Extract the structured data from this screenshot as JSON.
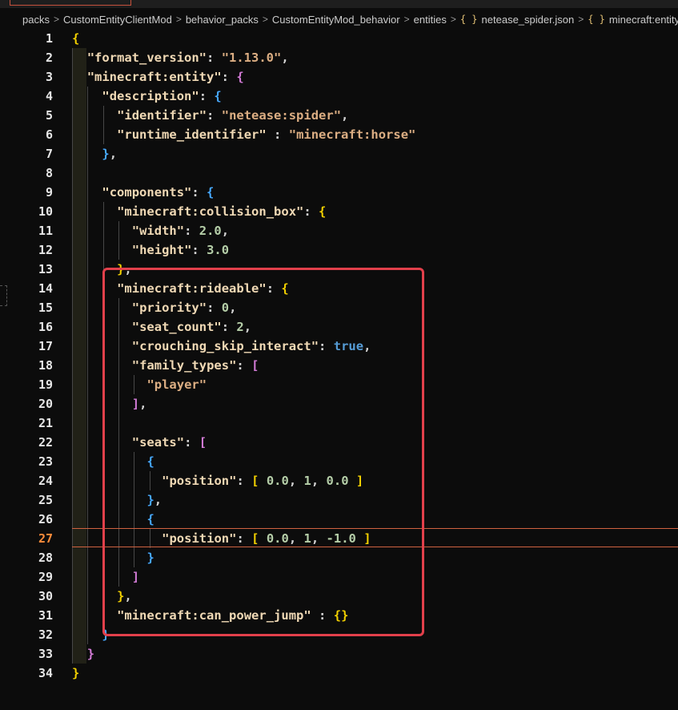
{
  "breadcrumb": {
    "items": [
      "packs",
      "CustomEntityClientMod",
      "behavior_packs",
      "CustomEntityMod_behavior",
      "entities",
      "netease_spider.json",
      "minecraft:entity",
      "{"
    ],
    "separator": ">",
    "icons": [
      "",
      "",
      "",
      "",
      "",
      "braces-icon",
      "braces-icon",
      ""
    ]
  },
  "editor": {
    "active_line": 27,
    "lines": [
      {
        "n": "1",
        "t": "{"
      },
      {
        "n": "2",
        "t": "  \"format_version\": \"1.13.0\","
      },
      {
        "n": "3",
        "t": "  \"minecraft:entity\": {"
      },
      {
        "n": "4",
        "t": "    \"description\": {"
      },
      {
        "n": "5",
        "t": "      \"identifier\": \"netease:spider\","
      },
      {
        "n": "6",
        "t": "      \"runtime_identifier\" : \"minecraft:horse\""
      },
      {
        "n": "7",
        "t": "    },"
      },
      {
        "n": "8",
        "t": ""
      },
      {
        "n": "9",
        "t": "    \"components\": {"
      },
      {
        "n": "10",
        "t": "      \"minecraft:collision_box\": {"
      },
      {
        "n": "11",
        "t": "        \"width\": 2.0,"
      },
      {
        "n": "12",
        "t": "        \"height\": 3.0"
      },
      {
        "n": "13",
        "t": "      },"
      },
      {
        "n": "14",
        "t": "      \"minecraft:rideable\": {"
      },
      {
        "n": "15",
        "t": "        \"priority\": 0,"
      },
      {
        "n": "16",
        "t": "        \"seat_count\": 2,"
      },
      {
        "n": "17",
        "t": "        \"crouching_skip_interact\": true,"
      },
      {
        "n": "18",
        "t": "        \"family_types\": ["
      },
      {
        "n": "19",
        "t": "          \"player\""
      },
      {
        "n": "20",
        "t": "        ],"
      },
      {
        "n": "21",
        "t": ""
      },
      {
        "n": "22",
        "t": "        \"seats\": ["
      },
      {
        "n": "23",
        "t": "          {"
      },
      {
        "n": "24",
        "t": "            \"position\": [ 0.0, 1, 0.0 ]"
      },
      {
        "n": "25",
        "t": "          },"
      },
      {
        "n": "26",
        "t": "          {"
      },
      {
        "n": "27",
        "t": "            \"position\": [ 0.0, 1, -1.0 ]"
      },
      {
        "n": "28",
        "t": "          }"
      },
      {
        "n": "29",
        "t": "        ]"
      },
      {
        "n": "30",
        "t": "      },"
      },
      {
        "n": "31",
        "t": "      \"minecraft:can_power_jump\" : {}"
      },
      {
        "n": "32",
        "t": "    }"
      },
      {
        "n": "33",
        "t": "  }"
      },
      {
        "n": "34",
        "t": "}"
      }
    ]
  },
  "colors": {
    "key": "#f0d9b5",
    "string": "#dcae83",
    "number": "#b5cea8",
    "boolean": "#569cd6",
    "active_line_number": "#ff8c3a",
    "highlight_box": "#e2404b"
  }
}
